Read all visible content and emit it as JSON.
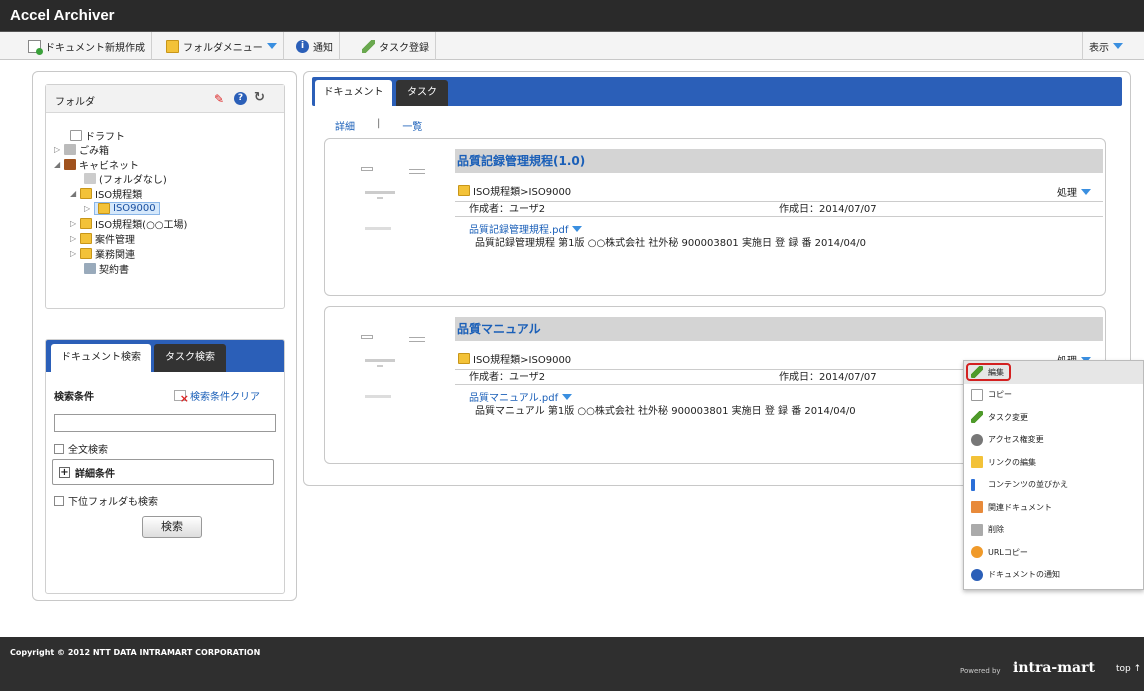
{
  "app": {
    "title": "Accel Archiver"
  },
  "toolbar": {
    "new_doc": "ドキュメント新規作成",
    "folder_menu": "フォルダメニュー",
    "notify": "通知",
    "task_register": "タスク登録",
    "view": "表示"
  },
  "left": {
    "folder_title": "フォルダ",
    "tree": [
      {
        "label": "ドラフト"
      },
      {
        "label": "ごみ箱"
      },
      {
        "label": "キャビネット"
      },
      {
        "label": "(フォルダなし)"
      },
      {
        "label": "ISO規程類"
      },
      {
        "label": "ISO9000"
      },
      {
        "label": "ISO規程類(○○工場)"
      },
      {
        "label": "案件管理"
      },
      {
        "label": "業務関連"
      },
      {
        "label": "契約書"
      }
    ],
    "search_tabs": [
      "ドキュメント検索",
      "タスク検索"
    ],
    "search_condition": "検索条件",
    "clear_condition": "検索条件クリア",
    "fulltext": "全文検索",
    "detail_condition": "詳細条件",
    "include_sub": "下位フォルダも検索",
    "search_button": "検索"
  },
  "main": {
    "tabs": [
      "ドキュメント",
      "タスク"
    ],
    "view_detail": "詳細",
    "view_list": "一覧",
    "view_sep": "|",
    "process": "処理",
    "author_label": "作成者：",
    "created_label": "作成日：",
    "docs": [
      {
        "title": "品質記録管理規程(1.0)",
        "path": "ISO規程類>ISO9000",
        "author": "ユーザ2",
        "date": "2014/07/07",
        "file": "品質記録管理規程.pdf",
        "desc": "品質記録管理規程 第1版 ○○株式会社 社外秘 900003801 実施日 登 録 番 2014/04/0"
      },
      {
        "title": "品質マニュアル",
        "path": "ISO規程類>ISO9000",
        "author": "ユーザ2",
        "date": "2014/07/07",
        "file": "品質マニュアル.pdf",
        "desc": "品質マニュアル 第1版 ○○株式会社 社外秘 900003801 実施日 登 録 番 2014/04/0"
      }
    ]
  },
  "context_menu": {
    "items": [
      "編集",
      "コピー",
      "タスク変更",
      "アクセス権変更",
      "リンクの編集",
      "コンテンツの並びかえ",
      "関連ドキュメント",
      "削除",
      "URLコピー",
      "ドキュメントの通知"
    ]
  },
  "footer": {
    "copyright": "Copyright © 2012 NTT DATA INTRAMART CORPORATION",
    "powered_by": "Powered by",
    "brand": "intra-mart",
    "top": "top ↑"
  },
  "colors": {
    "accent": "#2b5fb8",
    "link": "#1a5fb8",
    "highlight": "#d32020"
  }
}
